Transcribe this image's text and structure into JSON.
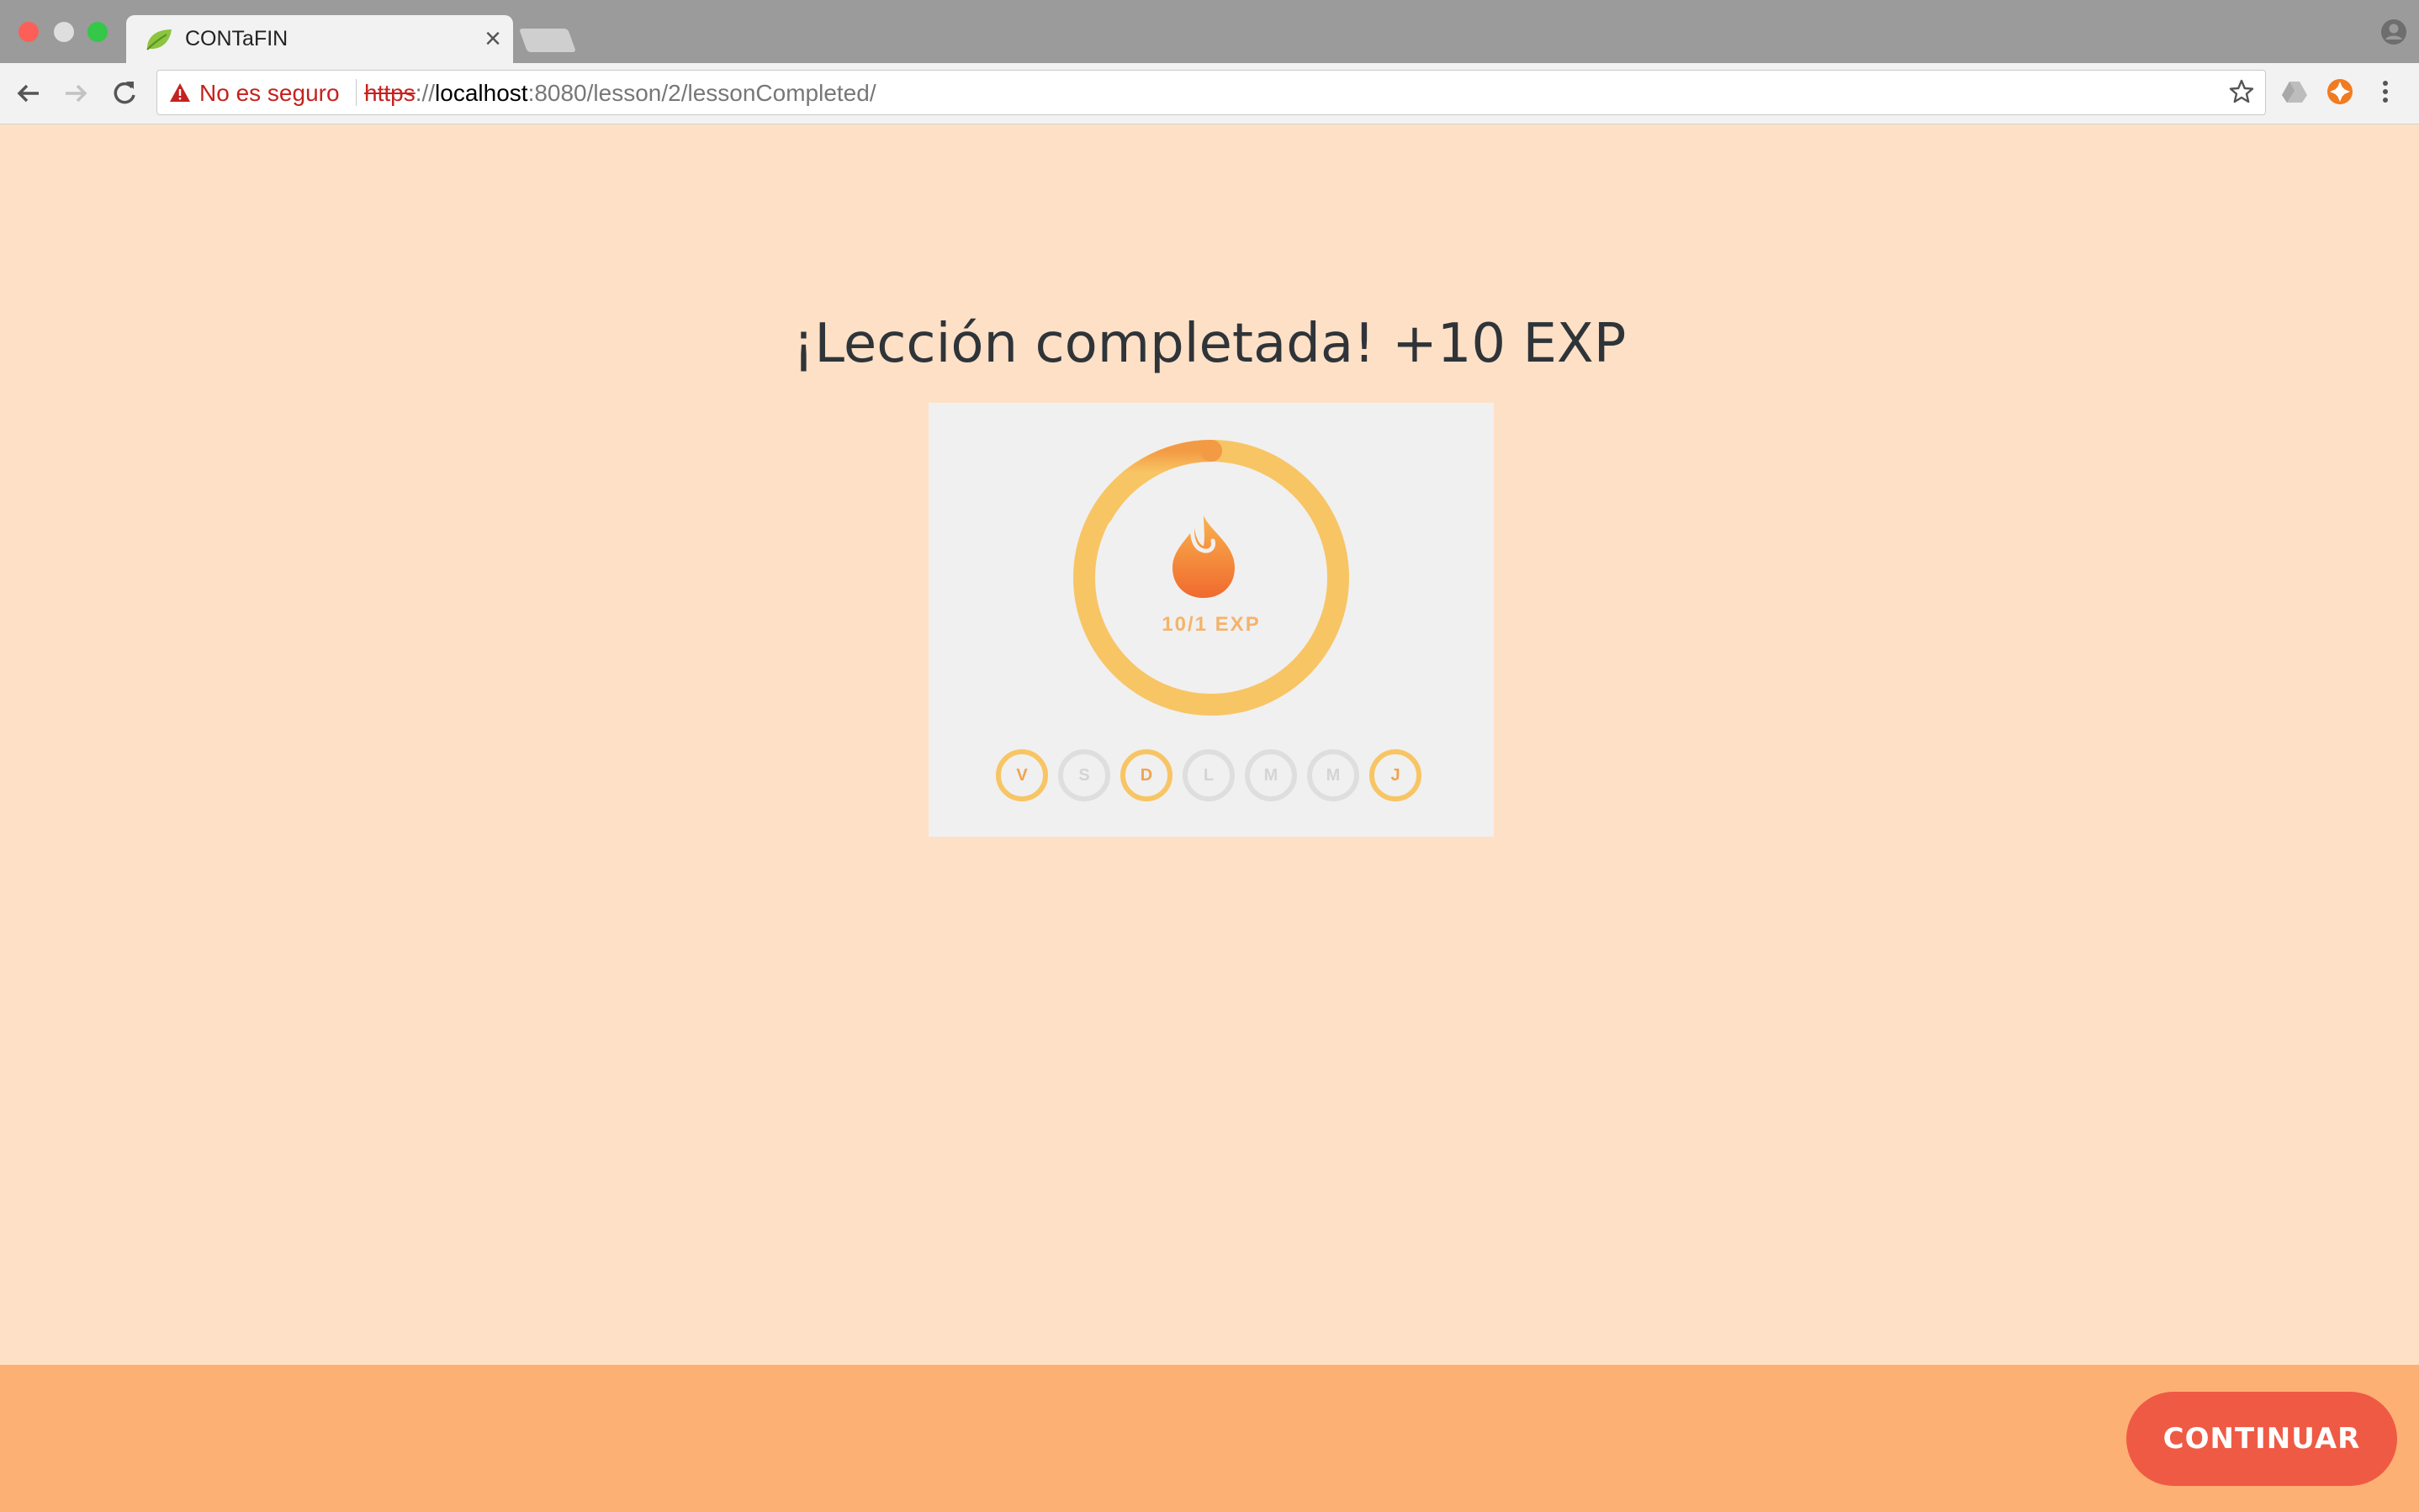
{
  "browser": {
    "tab_title": "CONTaFIN",
    "tab_close": "×",
    "security_text": "No es seguro",
    "url": {
      "scheme": "https",
      "separator": "://",
      "host": "localhost",
      "path": ":8080/lesson/2/lessonCompleted/"
    }
  },
  "page": {
    "heading": "¡Lección completada! +10 EXP",
    "progress": {
      "label": "10/1 EXP",
      "ring_fraction": 1.0
    },
    "days": [
      {
        "letter": "V",
        "active": true
      },
      {
        "letter": "S",
        "active": false
      },
      {
        "letter": "D",
        "active": true
      },
      {
        "letter": "L",
        "active": false
      },
      {
        "letter": "M",
        "active": false
      },
      {
        "letter": "M",
        "active": false
      },
      {
        "letter": "J",
        "active": true
      }
    ]
  },
  "footer": {
    "continue_label": "CONTINUAR"
  },
  "colors": {
    "page_bg": "#fde0c6",
    "footer_bg": "#fdb073",
    "button": "#ef5a45",
    "ring": "#f8c565",
    "ring_accent": "#f39a44"
  }
}
